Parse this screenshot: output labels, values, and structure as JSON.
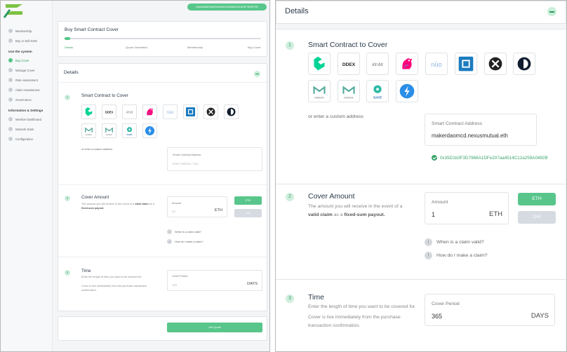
{
  "sidebar": {
    "items": [
      {
        "label": "Membership"
      },
      {
        "label": "Buy or Sell NXM"
      },
      {
        "label": "Buy Cover"
      },
      {
        "label": "Manage Cover"
      },
      {
        "label": "Risk Assessment"
      },
      {
        "label": "Claim Assessment"
      },
      {
        "label": "Governance"
      },
      {
        "label": "Member Dashboard"
      },
      {
        "label": "Network Stats"
      },
      {
        "label": "Configuration"
      }
    ],
    "section_headers": [
      "Use the system",
      "Information & Settings"
    ],
    "active_item": "Buy Cover"
  },
  "header": {
    "wallet_address": "0xAAAB4AF6A3ED0A4D4E3A3D6AED01AC6F76D6F70E"
  },
  "progress": {
    "title": "Buy Smart Contract Cover",
    "steps": [
      "Details",
      "Quote Generated",
      "Membership",
      "Buy Cover"
    ],
    "current_step_index": 0
  },
  "details": {
    "title": "Details",
    "contract_section": {
      "number": "1",
      "title": "Smart Contract to Cover",
      "custom_address_label": "or enter a custom address",
      "address_field": {
        "label": "Smart Contract Address",
        "placeholder": "Enter Address / ens",
        "value": "makerdaomcd.nexusmutual.eth"
      },
      "resolved_address": "0x35D1b3F3D7966A1DFe207aa4514C12a259A0492B",
      "logos": [
        "compound-logo",
        "ddex-logo",
        "dy-dx-logo",
        "uniswap-logo",
        "nuo-logo",
        "bancor-logo",
        "0x-logo",
        "dharma-logo",
        "maker-single-collateral-logo",
        "maker-multi-collateral-logo",
        "gnosis-safe-logo",
        "instadapp-logo"
      ],
      "logo_text": {
        "ddex": "DDEX",
        "dydx": "δY/δX",
        "nuo": "nūo",
        "safe": "SAFE",
        "maker": "MAKER"
      }
    },
    "amount_section": {
      "number": "2",
      "title": "Cover Amount",
      "desc_prefix": "The amount you will receive in the event of a",
      "desc_bold1": "valid claim",
      "desc_mid": "as a",
      "desc_bold2": "fixed-sum payout.",
      "amount_label": "Amount",
      "amount_placeholder": "10",
      "amount_value": "1",
      "amount_unit": "ETH",
      "currency_eth": "ETH",
      "currency_dai": "DAI",
      "help1": "When is a claim valid?",
      "help2": "How do I make a claim?"
    },
    "time_section": {
      "number": "3",
      "title": "Time",
      "desc1": "Enter the length of time you want to be covered for.",
      "desc2": "Cover is live immediately from the purchase transaction confirmation.",
      "period_label": "Cover Period",
      "period_placeholder": "150",
      "period_value": "365",
      "period_unit": "DAYS"
    }
  },
  "get_quote_label": "Get Quote",
  "colors": {
    "accent": "#58c68b",
    "accent_light": "#cfeedd",
    "disabled_button": "#d5dbe0",
    "text": "#2b3a4a"
  }
}
